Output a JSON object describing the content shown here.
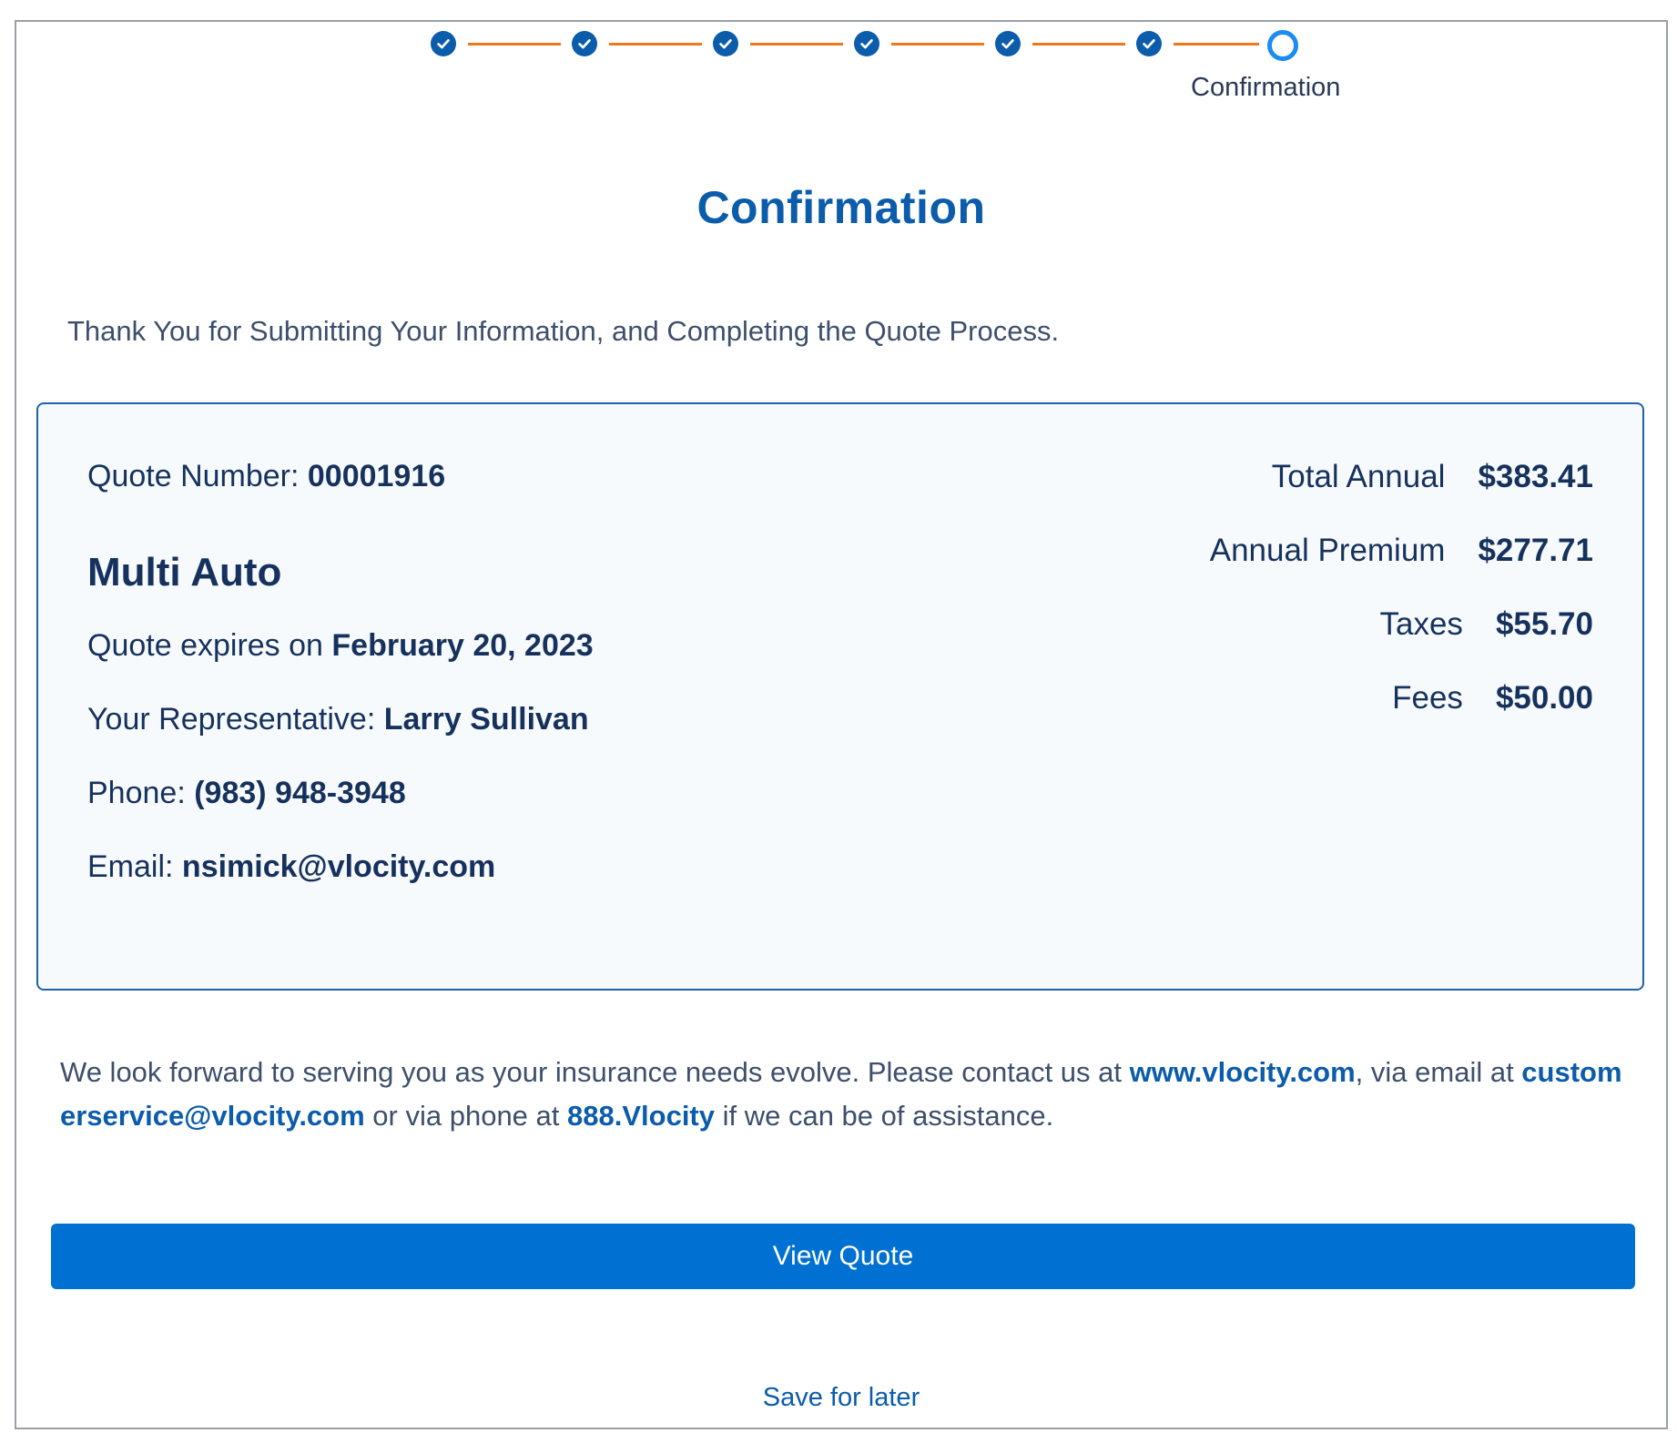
{
  "stepper": {
    "completed_steps": 6,
    "current_label": "Confirmation",
    "colors": {
      "done": "#0b5cab",
      "connector": "#f0771d",
      "current_ring": "#1b8cf0"
    }
  },
  "page": {
    "title": "Confirmation",
    "thanks": "Thank You for Submitting Your Information, and Completing the Quote Process."
  },
  "quote": {
    "number_label": "Quote Number:",
    "number": "00001916",
    "product": "Multi Auto",
    "expires_label": "Quote expires on",
    "expires": "February 20, 2023",
    "rep_label": "Your Representative:",
    "rep": "Larry Sullivan",
    "phone_label": "Phone:",
    "phone": "(983) 948-3948",
    "email_label": "Email:",
    "email": "nsimick@vlocity.com"
  },
  "summary": {
    "total_label": "Total Annual",
    "total": "$383.41",
    "premium_label": "Annual Premium",
    "premium": "$277.71",
    "taxes_label": "Taxes",
    "taxes": "$55.70",
    "fees_label": "Fees",
    "fees": "$50.00"
  },
  "footer": {
    "part1": "We look forward to serving you as your insurance needs evolve. Please contact us at ",
    "website": "www.vlocity.com",
    "part2": ", via email at ",
    "email": "customerservice@vlocity.com",
    "part3": " or via phone at ",
    "phone": "888.Vlocity",
    "part4": " if we can be of assistance."
  },
  "actions": {
    "view_quote": "View Quote",
    "save_later": "Save for later"
  }
}
